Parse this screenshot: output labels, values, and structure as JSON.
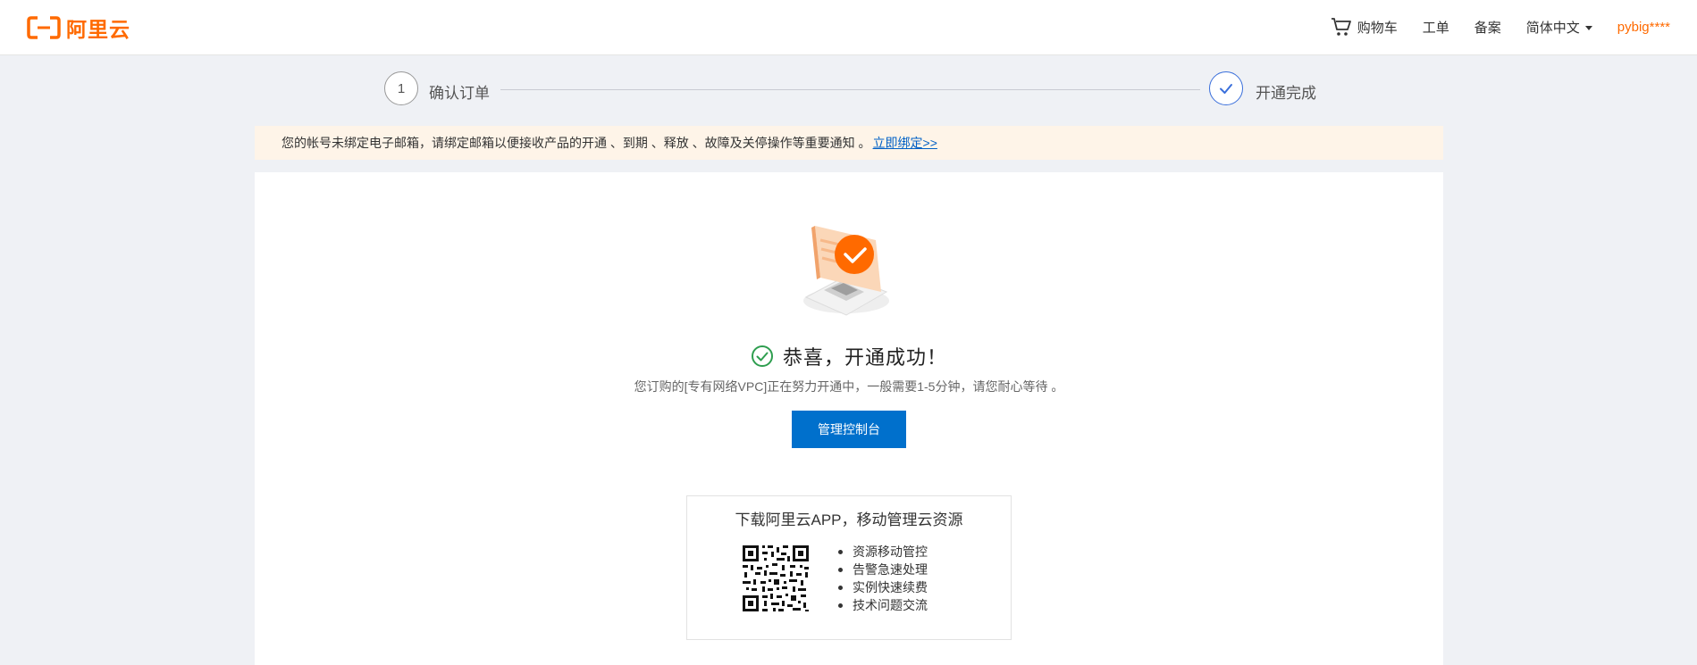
{
  "header": {
    "logo_text": "阿里云",
    "nav": {
      "cart_label": "购物车",
      "ticket_label": "工单",
      "record_label": "备案",
      "language_label": "简体中文",
      "user_label": "pybig****"
    }
  },
  "steps": [
    {
      "number": "1",
      "label": "确认订单"
    },
    {
      "label": "开通完成"
    }
  ],
  "notice": {
    "text": "您的帐号未绑定电子邮箱，请绑定邮箱以便接收产品的开通 、到期 、释放 、故障及关停操作等重要通知 。",
    "link_text": "立即绑定>>"
  },
  "result": {
    "title": "恭喜，开通成功！",
    "description": "您订购的[专有网络VPC]正在努力开通中，一般需要1-5分钟，请您耐心等待 。",
    "button_label": "管理控制台"
  },
  "app_promo": {
    "title": "下载阿里云APP，移动管理云资源",
    "features": [
      "资源移动管控",
      "告警急速处理",
      "实例快速续费",
      "技术问题交流"
    ]
  },
  "colors": {
    "brand": "#ff6a00",
    "primary_button": "#0070cc",
    "link": "#0060c6",
    "success": "#2e9e4f",
    "step_active": "#3a6fdb",
    "notice_bg": "#fef4e8",
    "page_bg": "#eff1f5"
  },
  "icons": [
    "aliyun-logo-icon",
    "cart-icon",
    "chevron-down-icon",
    "checkmark-icon",
    "success-check-icon",
    "qr-code"
  ]
}
